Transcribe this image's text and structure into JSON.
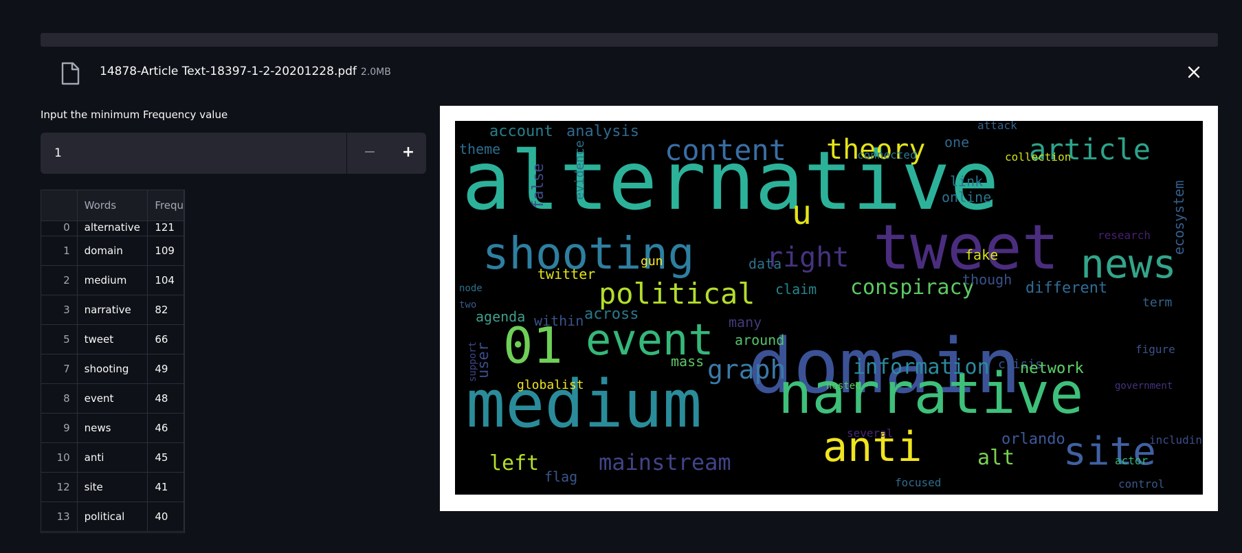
{
  "file": {
    "name": "14878-Article Text-18397-1-2-20201228.pdf",
    "size": "2.0MB"
  },
  "input": {
    "label": "Input the minimum Frequency value",
    "value": "1",
    "minus": "−",
    "plus": "+"
  },
  "table": {
    "headers": [
      "",
      "Words",
      "Frequ"
    ],
    "rows": [
      [
        "0",
        "alternative",
        "121"
      ],
      [
        "1",
        "domain",
        "109"
      ],
      [
        "2",
        "medium",
        "104"
      ],
      [
        "3",
        "narrative",
        "82"
      ],
      [
        "5",
        "tweet",
        "66"
      ],
      [
        "7",
        "shooting",
        "49"
      ],
      [
        "8",
        "event",
        "48"
      ],
      [
        "9",
        "news",
        "46"
      ],
      [
        "10",
        "anti",
        "45"
      ],
      [
        "12",
        "site",
        "41"
      ],
      [
        "13",
        "political",
        "40"
      ]
    ]
  },
  "wordcloud": {
    "words": [
      {
        "text": "alternative",
        "color": "#2db29a"
      },
      {
        "text": "domain",
        "color": "#3b5296"
      },
      {
        "text": "medium",
        "color": "#2a8c9a"
      },
      {
        "text": "narrative",
        "color": "#3ec07a"
      },
      {
        "text": "tweet",
        "color": "#4b2d7f"
      },
      {
        "text": "shooting",
        "color": "#2e7fa0"
      },
      {
        "text": "event",
        "color": "#35b779"
      },
      {
        "text": "news",
        "color": "#33a58a"
      },
      {
        "text": "anti",
        "color": "#f0e51f"
      },
      {
        "text": "site",
        "color": "#4061a3"
      },
      {
        "text": "political",
        "color": "#b4dd2b"
      },
      {
        "text": "article",
        "color": "#2ca48b"
      },
      {
        "text": "content",
        "color": "#3a6ea5"
      },
      {
        "text": "theory",
        "color": "#e5e419"
      },
      {
        "text": "conspiracy",
        "color": "#5ec962"
      },
      {
        "text": "01",
        "color": "#6fcf57"
      },
      {
        "text": "graph",
        "color": "#3a7aa8"
      },
      {
        "text": "right",
        "color": "#46337f"
      },
      {
        "text": "mainstream",
        "color": "#414487"
      },
      {
        "text": "information",
        "color": "#2c8a9f"
      },
      {
        "text": "left",
        "color": "#b5de2b"
      },
      {
        "text": "alt",
        "color": "#7ad151"
      },
      {
        "text": "globalist",
        "color": "#f2e51d"
      },
      {
        "text": "twitter",
        "color": "#e2e418"
      },
      {
        "text": "different",
        "color": "#2f6d98"
      },
      {
        "text": "network",
        "color": "#5ac864"
      },
      {
        "text": "orlando",
        "color": "#3b5a9a"
      },
      {
        "text": "account",
        "color": "#287f8e"
      },
      {
        "text": "analysis",
        "color": "#31698e"
      },
      {
        "text": "agenda",
        "color": "#3e9f8e"
      },
      {
        "text": "user",
        "color": "#3a4d8a"
      },
      {
        "text": "around",
        "color": "#52c569"
      },
      {
        "text": "across",
        "color": "#2a788e"
      },
      {
        "text": "within",
        "color": "#3b528b"
      },
      {
        "text": "claim",
        "color": "#24868e"
      },
      {
        "text": "data",
        "color": "#2c728e"
      },
      {
        "text": "many",
        "color": "#44397a"
      },
      {
        "text": "fake",
        "color": "#d8e219"
      },
      {
        "text": "link",
        "color": "#2b748e"
      },
      {
        "text": "online",
        "color": "#2d718e"
      },
      {
        "text": "ecosystem",
        "color": "#355f8d"
      },
      {
        "text": "research",
        "color": "#482071"
      },
      {
        "text": "crisis",
        "color": "#38588c"
      },
      {
        "text": "mass",
        "color": "#5dc863"
      },
      {
        "text": "flag",
        "color": "#39568c"
      },
      {
        "text": "though",
        "color": "#3a528b"
      },
      {
        "text": "term",
        "color": "#32658e"
      },
      {
        "text": "including",
        "color": "#3d4d8a"
      },
      {
        "text": "network",
        "color": "#5ac864"
      },
      {
        "text": "focused",
        "color": "#2f6c8e"
      },
      {
        "text": "control",
        "color": "#38598c"
      },
      {
        "text": "actor",
        "color": "#35b779"
      },
      {
        "text": "several",
        "color": "#482878"
      },
      {
        "text": "theme",
        "color": "#2e6d8e"
      },
      {
        "text": "one",
        "color": "#31688e"
      },
      {
        "text": "connected",
        "color": "#2a788e"
      },
      {
        "text": "collection",
        "color": "#d2e21b"
      },
      {
        "text": "evidence",
        "color": "#2c728e"
      },
      {
        "text": "false",
        "color": "#3e4a89"
      },
      {
        "text": "figure",
        "color": "#3b528b"
      },
      {
        "text": "hosted",
        "color": "#5dc863"
      },
      {
        "text": "government",
        "color": "#46327e"
      },
      {
        "text": "attack",
        "color": "#33628d"
      },
      {
        "text": "gun",
        "color": "#fde725"
      },
      {
        "text": "node",
        "color": "#2d708e"
      },
      {
        "text": "two",
        "color": "#38588c"
      },
      {
        "text": "support",
        "color": "#3f4788"
      },
      {
        "text": "u",
        "color": "#e5e419"
      }
    ]
  }
}
